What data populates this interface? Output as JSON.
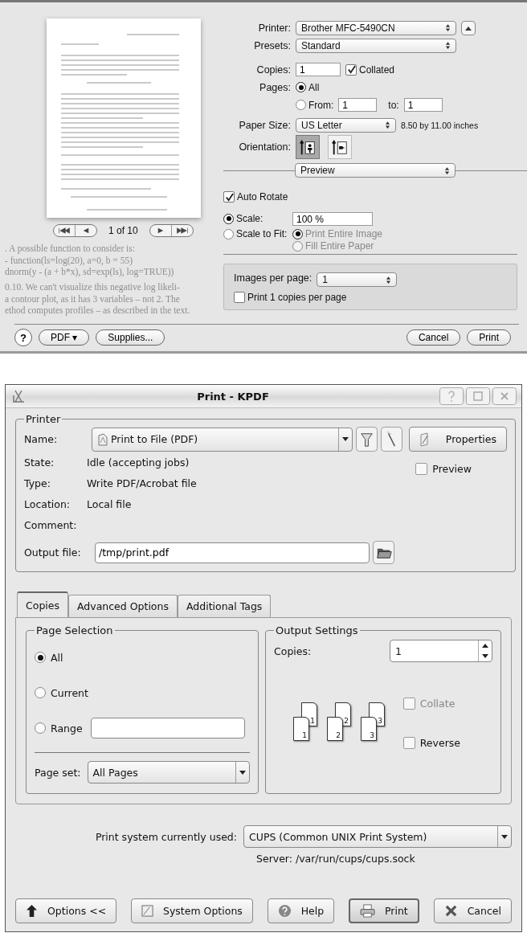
{
  "mac_dialog": {
    "background_text": [
      ". A possible function to consider is:",
      "- function(ls=log(20), a=0, b = 55)",
      "dnorm(y - (a + b*x), sd=exp(ls), log=TRUE))",
      "0.10. We can't visualize this negative log likeli-",
      "a contour plot, as it has 3 variables – not 2. The",
      "ethod computes profiles – as described in the text."
    ],
    "preview": {
      "page_indicator": "1 of 10"
    },
    "printer": {
      "label": "Printer:",
      "value": "Brother MFC-5490CN"
    },
    "presets": {
      "label": "Presets:",
      "value": "Standard"
    },
    "copies": {
      "label": "Copies:",
      "value": "1",
      "collated": {
        "label": "Collated",
        "checked": true
      }
    },
    "pages": {
      "label": "Pages:",
      "options": [
        {
          "label": "All",
          "selected": true
        },
        {
          "label": "From:",
          "selected": false
        }
      ],
      "from": "1",
      "to_label": "to:",
      "to": "1"
    },
    "paper_size": {
      "label": "Paper Size:",
      "value": "US Letter",
      "note": "8.50 by 11.00 inches"
    },
    "orientation": {
      "label": "Orientation:",
      "options": [
        {
          "kind": "portrait",
          "selected": true
        },
        {
          "kind": "landscape",
          "selected": false
        }
      ]
    },
    "section": "Preview",
    "auto_rotate": {
      "label": "Auto Rotate",
      "checked": true
    },
    "scale": {
      "options": [
        {
          "label": "Scale:",
          "selected": true
        },
        {
          "label": "Scale to Fit:",
          "selected": false
        }
      ],
      "value": "100 %",
      "fit_options": [
        {
          "label": "Print Entire Image",
          "selected": true,
          "disabled": true
        },
        {
          "label": "Fill Entire Paper",
          "selected": false,
          "disabled": true
        }
      ]
    },
    "images_per_page": {
      "label": "Images per page:",
      "value": "1"
    },
    "copies_per_page": {
      "label": "Print 1 copies per page",
      "checked": false
    },
    "help": "?",
    "pdf": "PDF ▾",
    "supplies": "Supplies...",
    "cancel": "Cancel",
    "print": "Print"
  },
  "kde_dialog": {
    "title": "Print - KPDF",
    "printer_group": {
      "title": "Printer",
      "name": {
        "label": "Name:",
        "value": "Print to File (PDF)"
      },
      "properties": "Properties",
      "preview": {
        "label": "Preview",
        "checked": false
      },
      "info": [
        {
          "label": "State:",
          "value": "Idle (accepting jobs)"
        },
        {
          "label": "Type:",
          "value": "Write PDF/Acrobat file"
        },
        {
          "label": "Location:",
          "value": "Local file"
        },
        {
          "label": "Comment:"
        }
      ],
      "output_file": {
        "label": "Output file:",
        "value": "/tmp/print.pdf"
      }
    },
    "tabs": [
      {
        "label": "Copies",
        "selected": true
      },
      {
        "label": "Advanced Options",
        "selected": false
      },
      {
        "label": "Additional Tags",
        "selected": false
      }
    ],
    "page_selection": {
      "title": "Page Selection",
      "options": [
        {
          "label": "All",
          "selected": true
        },
        {
          "label": "Current",
          "selected": false
        },
        {
          "label": "Range",
          "selected": false
        }
      ],
      "page_set": {
        "label": "Page set:",
        "value": "All Pages"
      }
    },
    "output_settings": {
      "title": "Output Settings",
      "copies": {
        "label": "Copies:",
        "value": "1"
      },
      "collate": {
        "label": "Collate",
        "checked": false,
        "disabled": true
      },
      "reverse": {
        "label": "Reverse",
        "checked": false,
        "disabled": false
      },
      "page_stacks": [
        {
          "back": "1",
          "front": "1"
        },
        {
          "back": "2",
          "front": "2"
        },
        {
          "back": "3",
          "front": "3"
        }
      ]
    },
    "print_system": {
      "label": "Print system currently used:",
      "value": "CUPS (Common UNIX Print System)",
      "server": "Server: /var/run/cups/cups.sock"
    },
    "buttons": [
      {
        "kind": "options",
        "label": "Options <<",
        "default": false
      },
      {
        "kind": "system",
        "label": "System Options",
        "default": false
      },
      {
        "kind": "help",
        "label": "Help",
        "default": false
      },
      {
        "kind": "print",
        "label": "Print",
        "default": true
      },
      {
        "kind": "cancel",
        "label": "Cancel",
        "default": false
      }
    ]
  }
}
